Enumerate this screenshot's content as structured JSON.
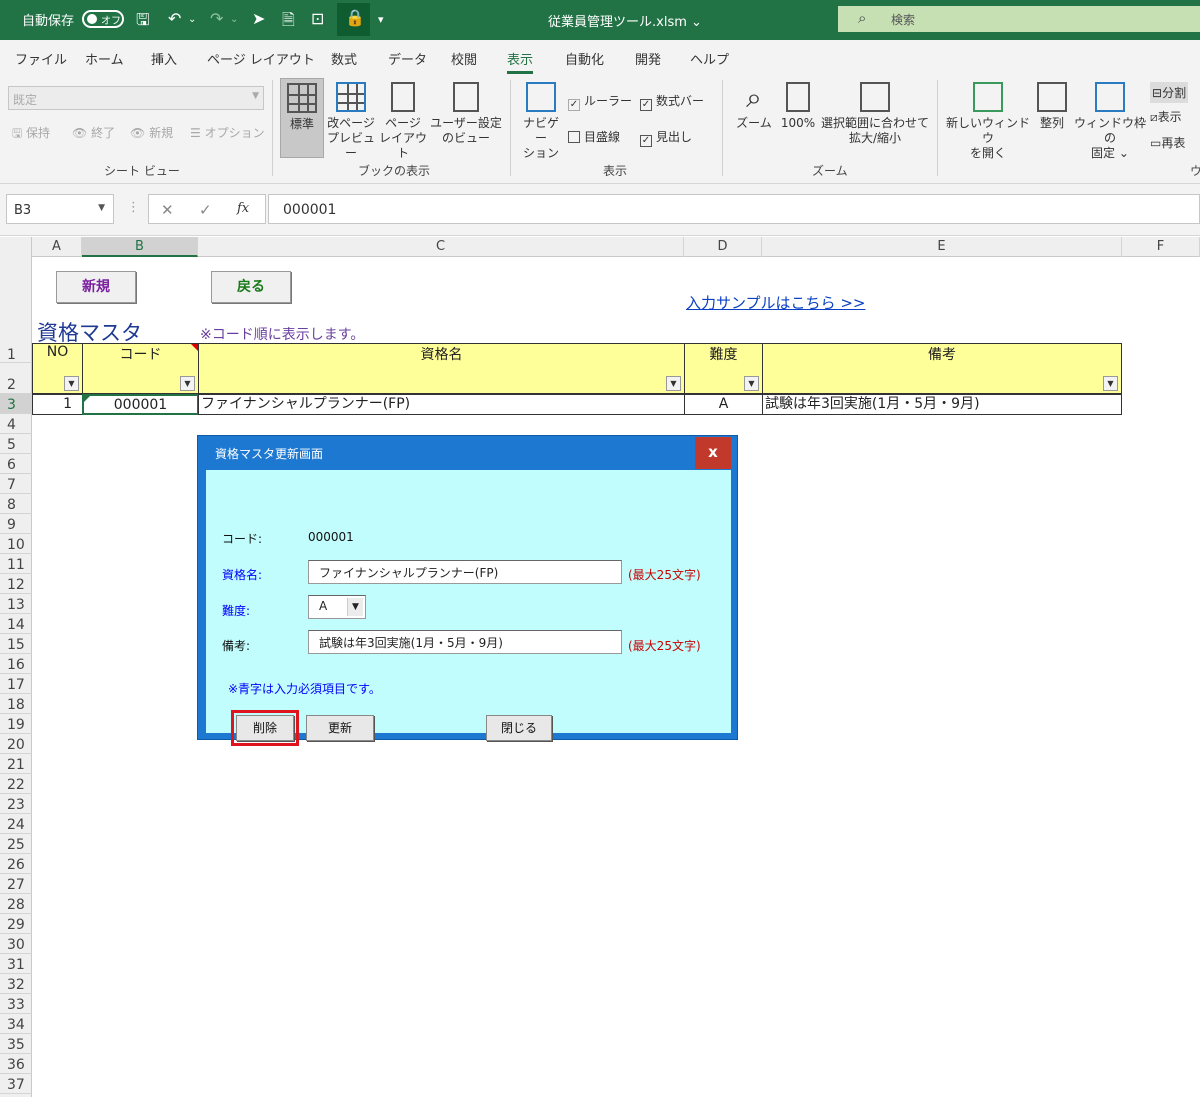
{
  "titlebar": {
    "autosave_label": "自動保存",
    "toggle_state": "オフ",
    "filename": "従業員管理ツール.xlsm",
    "search_placeholder": "検索"
  },
  "menu": {
    "tabs": [
      "ファイル",
      "ホーム",
      "挿入",
      "ページ レイアウト",
      "数式",
      "データ",
      "校閲",
      "表示",
      "自動化",
      "開発",
      "ヘルプ"
    ],
    "active_tab": "表示"
  },
  "ribbon": {
    "sheetview": {
      "combo_value": "既定",
      "keep": "保持",
      "exit": "終了",
      "new": "新規",
      "options": "オプション",
      "group_label": "シート ビュー"
    },
    "bookview": {
      "normal": "標準",
      "pagebreak_line1": "改ページ",
      "pagebreak_line2": "プレビュー",
      "pagelayout_line1": "ページ",
      "pagelayout_line2": "レイアウト",
      "custom_line1": "ユーザー設定",
      "custom_line2": "のビュー",
      "group_label": "ブックの表示"
    },
    "show": {
      "navigation_line1": "ナビゲー",
      "navigation_line2": "ション",
      "ruler": "ルーラー",
      "formulabar": "数式バー",
      "gridlines": "目盛線",
      "headings": "見出し",
      "group_label": "表示"
    },
    "zoom": {
      "zoom": "ズーム",
      "hundred": "100%",
      "selection_line1": "選択範囲に合わせて",
      "selection_line2": "拡大/縮小",
      "group_label": "ズーム"
    },
    "window": {
      "newwindow_line1": "新しいウィンドウ",
      "newwindow_line2": "を開く",
      "arrange": "整列",
      "freeze_line1": "ウィンドウ枠の",
      "freeze_line2": "固定",
      "split": "分割",
      "hide": "表示",
      "unhide": "再表",
      "group_label": "ウ"
    }
  },
  "formulabar": {
    "namebox": "B3",
    "content": "000001"
  },
  "columns": [
    "A",
    "B",
    "C",
    "D",
    "E",
    "F"
  ],
  "rows": [
    "1",
    "2",
    "3",
    "4",
    "5",
    "6",
    "7",
    "8",
    "9",
    "10",
    "11",
    "12",
    "13",
    "14",
    "15",
    "16",
    "17",
    "18",
    "19",
    "20",
    "21",
    "22",
    "23",
    "24",
    "25",
    "26",
    "27",
    "28",
    "29",
    "30",
    "31",
    "32",
    "33",
    "34",
    "35",
    "36",
    "37"
  ],
  "sheet": {
    "btn_new": "新規",
    "btn_back": "戻る",
    "sample_link": "入力サンプルはこちら >>",
    "title": "資格マスタ",
    "note": "※コード順に表示します。",
    "headers": [
      "NO",
      "コード",
      "資格名",
      "難度",
      "備考"
    ],
    "row": {
      "no": "1",
      "code": "000001",
      "name": "ファイナンシャルプランナー(FP)",
      "level": "A",
      "remark": "試験は年3回実施(1月・5月・9月)"
    }
  },
  "dialog": {
    "title": "資格マスタ更新画面",
    "close": "x",
    "code_label": "コード:",
    "code_value": "000001",
    "name_label": "資格名:",
    "name_value": "ファイナンシャルプランナー(FP)",
    "name_note": "(最大25文字)",
    "level_label": "難度:",
    "level_value": "A",
    "remark_label": "備考:",
    "remark_value": "試験は年3回実施(1月・5月・9月)",
    "remark_note": "(最大25文字)",
    "required_note": "※青字は入力必須項目です。",
    "btn_delete": "削除",
    "btn_update": "更新",
    "btn_close": "閉じる"
  },
  "colors": {
    "excel_green": "#217346",
    "header_fill": "#ffff99",
    "dialog_body": "#c2fdfd",
    "dialog_frame": "#1c78d1",
    "highlight": "#e0141e",
    "required_blue": "#0000ff"
  }
}
